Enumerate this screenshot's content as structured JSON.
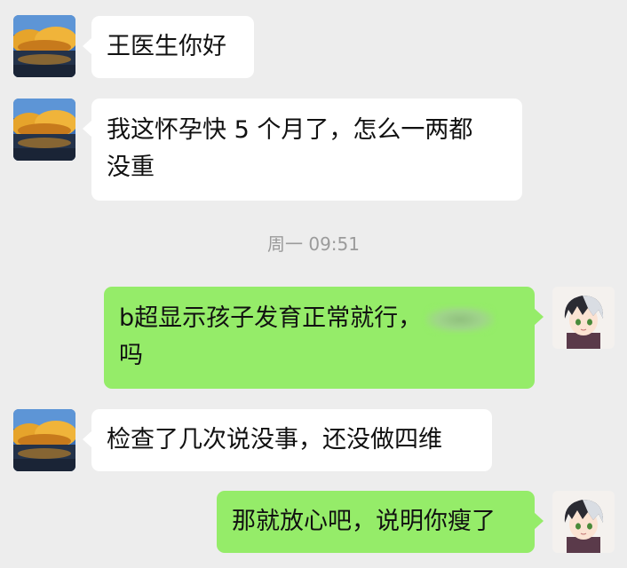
{
  "timestamp": "周一 09:51",
  "messages": [
    {
      "side": "in",
      "avatar": "landscape-avatar",
      "lines": [
        "王医生你好"
      ]
    },
    {
      "side": "in",
      "avatar": "landscape-avatar",
      "lines": [
        "我这怀孕快 5 个月了，怎么一两都",
        "没重"
      ]
    },
    {
      "side": "out",
      "avatar": "anime-boy-avatar",
      "lines": [
        "b超显示孩子发育正常就行，",
        "吗"
      ]
    },
    {
      "side": "in",
      "avatar": "landscape-avatar",
      "lines": [
        "检查了几次说没事，还没做四维"
      ]
    },
    {
      "side": "out",
      "avatar": "anime-boy-avatar",
      "lines": [
        "那就放心吧，说明你瘦了"
      ]
    }
  ]
}
